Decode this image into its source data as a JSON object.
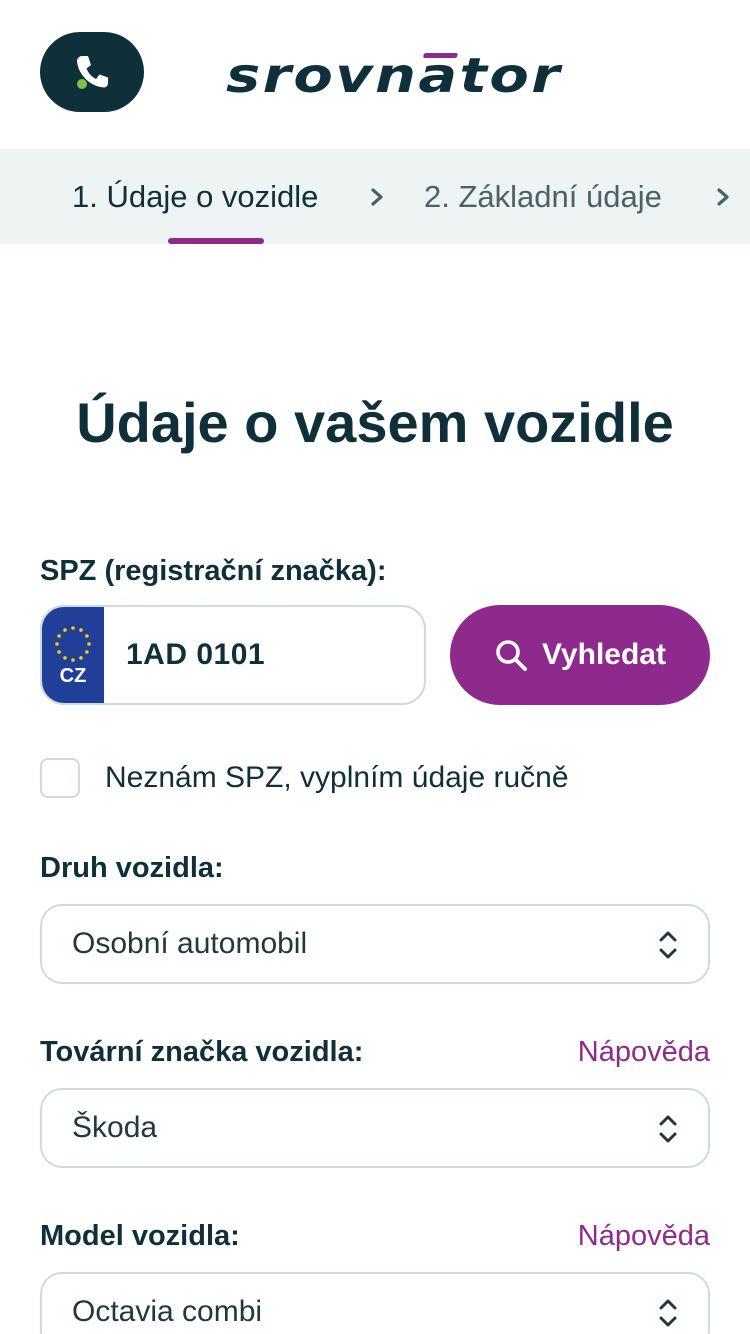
{
  "header": {
    "logo_text": "srovnator",
    "phone_icon": "phone-icon"
  },
  "steps": [
    {
      "label": "1. Údaje o vozidle",
      "active": true
    },
    {
      "label": "2. Základní údaje",
      "active": false
    }
  ],
  "page_title": "Údaje o vašem vozidle",
  "plate": {
    "label": "SPZ (registrační značka):",
    "country": "CZ",
    "value": "1AD 0101",
    "search_button": "Vyhledat"
  },
  "manual": {
    "checkbox_label": "Neznám SPZ, vyplním údaje ručně",
    "checked": false
  },
  "vehicle_type": {
    "label": "Druh vozidla:",
    "value": "Osobní automobil"
  },
  "brand": {
    "label": "Tovární značka vozidla:",
    "help": "Nápověda",
    "value": "Škoda"
  },
  "model": {
    "label": "Model vozidla:",
    "help": "Nápověda",
    "value": "Octavia combi"
  },
  "colors": {
    "primary": "#0f3038",
    "accent": "#8e2a8c",
    "green_dot": "#7cc243",
    "steps_bg": "#eef3f3",
    "eu_blue": "#1f3f99"
  }
}
